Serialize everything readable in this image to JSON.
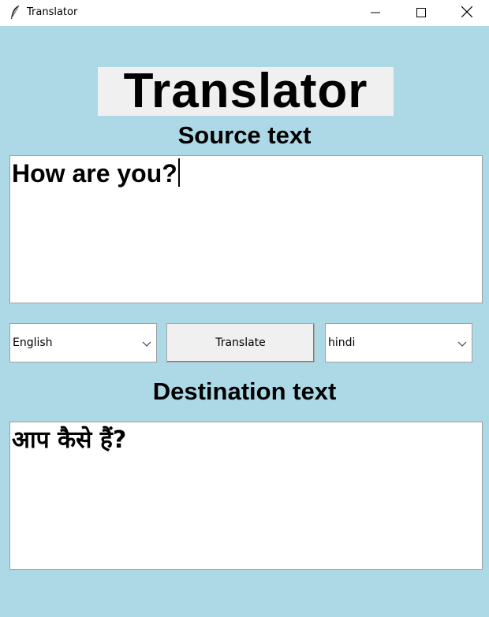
{
  "window": {
    "title": "Translator",
    "icons": {
      "app": "feather-icon",
      "minimize": "minimize-icon",
      "maximize": "maximize-icon",
      "close": "close-icon"
    }
  },
  "main": {
    "heading": "Translator",
    "source_label": "Source text",
    "source_text": "How are you?",
    "source_language": "English",
    "translate_label": "Translate",
    "destination_language": "hindi",
    "destination_label": "Destination text",
    "destination_text": "आप कैसे हैं?"
  },
  "colors": {
    "background": "#add8e6",
    "heading_bg": "#f0f0f0",
    "titlebar": "#ffffff"
  }
}
